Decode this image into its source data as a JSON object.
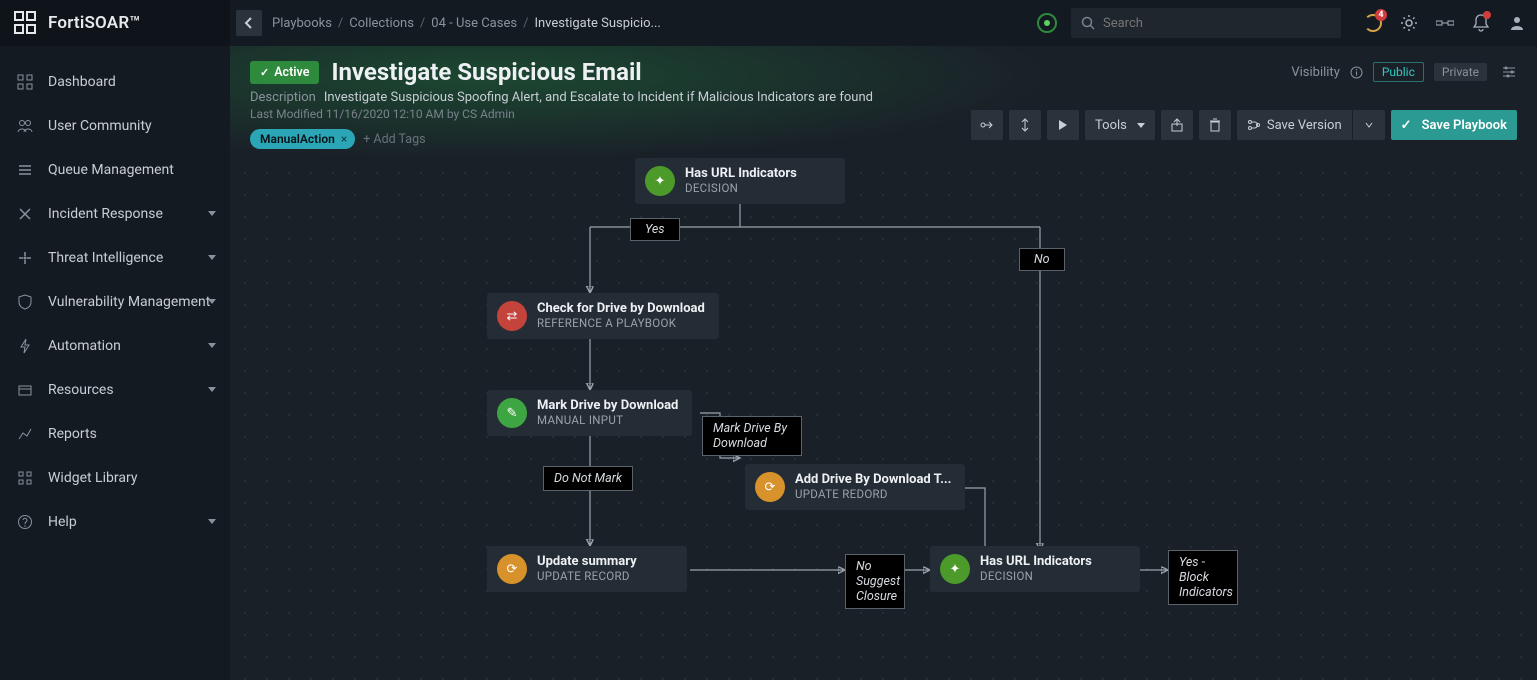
{
  "app": {
    "name": "FortiSOAR™"
  },
  "breadcrumb": {
    "items": [
      {
        "label": "Playbooks"
      },
      {
        "label": "Collections"
      },
      {
        "label": "04 - Use Cases"
      }
    ],
    "current": "Investigate Suspicio..."
  },
  "search": {
    "placeholder": "Search"
  },
  "notification_count": "4",
  "sidebar": {
    "items": [
      {
        "icon": "grid",
        "label": "Dashboard",
        "expandable": false
      },
      {
        "icon": "users",
        "label": "User Community",
        "expandable": false
      },
      {
        "icon": "queue",
        "label": "Queue Management",
        "expandable": false
      },
      {
        "icon": "incident",
        "label": "Incident Response",
        "expandable": true
      },
      {
        "icon": "threat",
        "label": "Threat Intelligence",
        "expandable": true
      },
      {
        "icon": "shield",
        "label": "Vulnerability Management",
        "expandable": true
      },
      {
        "icon": "bolt",
        "label": "Automation",
        "expandable": true
      },
      {
        "icon": "box",
        "label": "Resources",
        "expandable": true
      },
      {
        "icon": "chart",
        "label": "Reports",
        "expandable": false
      },
      {
        "icon": "widget",
        "label": "Widget Library",
        "expandable": false
      },
      {
        "icon": "help",
        "label": "Help",
        "expandable": true
      }
    ]
  },
  "header": {
    "status": "Active",
    "title": "Investigate Suspicious Email",
    "desc_label": "Description",
    "description": "Investigate Suspicious Spoofing Alert, and Escalate to Incident if Malicious Indicators are found",
    "modified_label": "Last Modified",
    "modified": "11/16/2020 12:10 AM by CS Admin",
    "tag": "ManualAction",
    "add_tags": "+ Add Tags",
    "visibility_label": "Visibility",
    "public": "Public",
    "private": "Private"
  },
  "toolbar": {
    "tools": "Tools",
    "save_version": "Save Version",
    "save_playbook": "Save Playbook"
  },
  "nodes": {
    "n1": {
      "title": "Has URL Indicators",
      "sub": "DECISION"
    },
    "n2": {
      "title": "Check for Drive by Download",
      "sub": "REFERENCE A PLAYBOOK"
    },
    "n3": {
      "title": "Mark Drive by Download",
      "sub": "MANUAL INPUT"
    },
    "n4": {
      "title": "Add Drive By Download T...",
      "sub": "UPDATE REDORD"
    },
    "n5": {
      "title": "Update summary",
      "sub": "UPDATE RECORD"
    },
    "n6": {
      "title": "Has URL Indicators",
      "sub": "DECISION"
    },
    "e_yes": "Yes",
    "e_no": "No",
    "e_mark": "Mark Drive By Download",
    "e_donot": "Do Not Mark",
    "e_nosuggest": "No Suggest Closure",
    "e_yesblock": "Yes - Block Indicators"
  }
}
